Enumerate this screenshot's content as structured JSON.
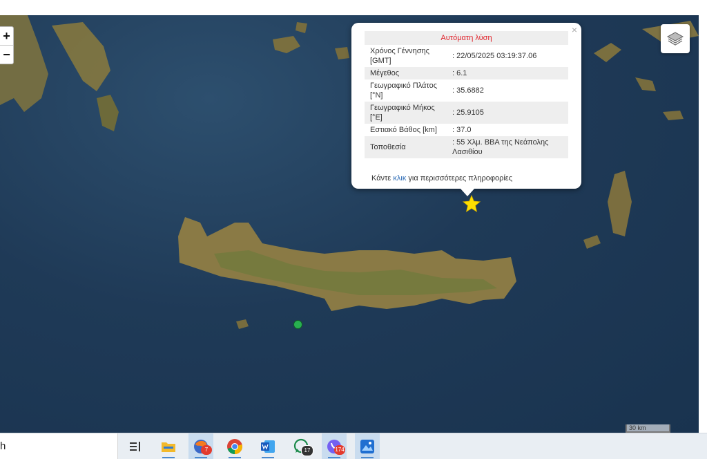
{
  "map": {
    "zoom_in_label": "+",
    "zoom_out_label": "−",
    "layers_icon": "layers-icon",
    "scale_label": "30 km"
  },
  "popup": {
    "title": "Αυτόματη λύση",
    "close_label": "×",
    "rows": [
      {
        "key": "Χρόνος Γέννησης [GMT]",
        "value": ": 22/05/2025 03:19:37.06"
      },
      {
        "key": "Μέγεθος",
        "value": ": 6.1"
      },
      {
        "key": "Γεωγραφικό Πλάτος [°N]",
        "value": ": 35.6882"
      },
      {
        "key": "Γεωγραφικό Μήκος [°E]",
        "value": ": 25.9105"
      },
      {
        "key": "Εστιακό Βάθος [km]",
        "value": ": 37.0"
      },
      {
        "key": "Τοποθεσία",
        "value": ": 55 Χλμ. ΒΒΑ της Νεάπολης Λασιθίου"
      }
    ],
    "more_prefix": "Κάντε",
    "more_link": "κλικ",
    "more_suffix": "για περισσότερες πληροφορίες"
  },
  "colors": {
    "title_red": "#e0222a",
    "star_yellow": "#ffde00",
    "station_green": "#28b050",
    "sea": "#1f3a57",
    "land": "#8a7a45"
  },
  "taskbar": {
    "search_text": "h",
    "apps": [
      {
        "name": "task-view-icon",
        "badge": ""
      },
      {
        "name": "file-explorer-icon",
        "badge": ""
      },
      {
        "name": "firefox-icon",
        "badge": "7"
      },
      {
        "name": "chrome-icon",
        "badge": ""
      },
      {
        "name": "word-icon",
        "badge": ""
      },
      {
        "name": "whatsapp-icon",
        "badge": "17"
      },
      {
        "name": "viber-icon",
        "badge": "174"
      },
      {
        "name": "photos-icon",
        "badge": ""
      }
    ]
  }
}
